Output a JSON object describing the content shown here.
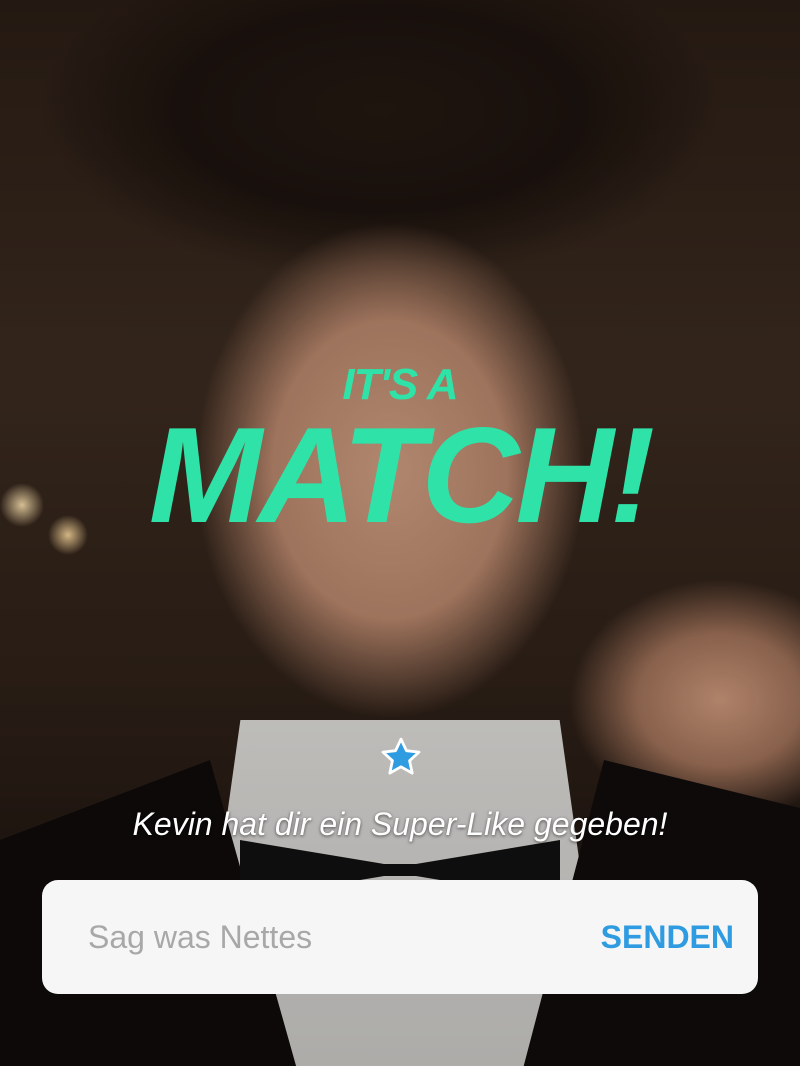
{
  "match": {
    "title_small": "IT'S A",
    "title_big": "MATCH!",
    "accent_color": "#2ee2a8"
  },
  "superlike": {
    "icon": "star-icon",
    "icon_color": "#2f9be0",
    "text": "Kevin hat dir ein Super-Like gegeben!"
  },
  "message": {
    "placeholder": "Sag was Nettes",
    "value": "",
    "send_label": "SENDEN",
    "send_color": "#2f9be0"
  }
}
